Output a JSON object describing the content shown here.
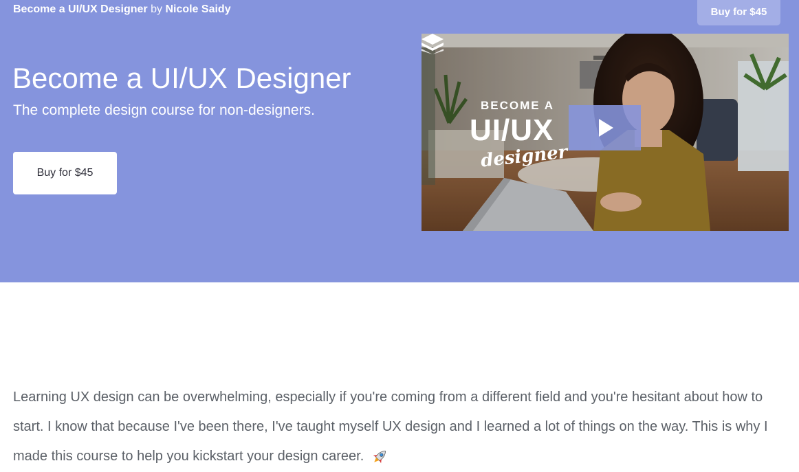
{
  "header": {
    "course_title": "Become a UI/UX Designer",
    "by_text": "by",
    "author": "Nicole Saidy",
    "buy_label": "Buy for $45"
  },
  "hero": {
    "title": "Become a UI/UX Designer",
    "subtitle": "The complete design course for non-designers.",
    "buy_label": "Buy for $45"
  },
  "video": {
    "become_text": "BECOME A",
    "uiux_text": "UI/UX",
    "designer_text": "designer",
    "play_icon": "play-icon"
  },
  "description": {
    "text": "Learning UX design can be overwhelming, especially if you're coming from a different field and you're hesitant about how to start. I know that because I've been there, I've taught myself UX design and I learned a lot of things on the way. This is why I made this course to help you kickstart your design career.",
    "emoji_icon": "rocket-icon"
  },
  "colors": {
    "hero_background": "#8594dd",
    "top_button": "#a3aee6",
    "body_text": "#5b6067"
  }
}
